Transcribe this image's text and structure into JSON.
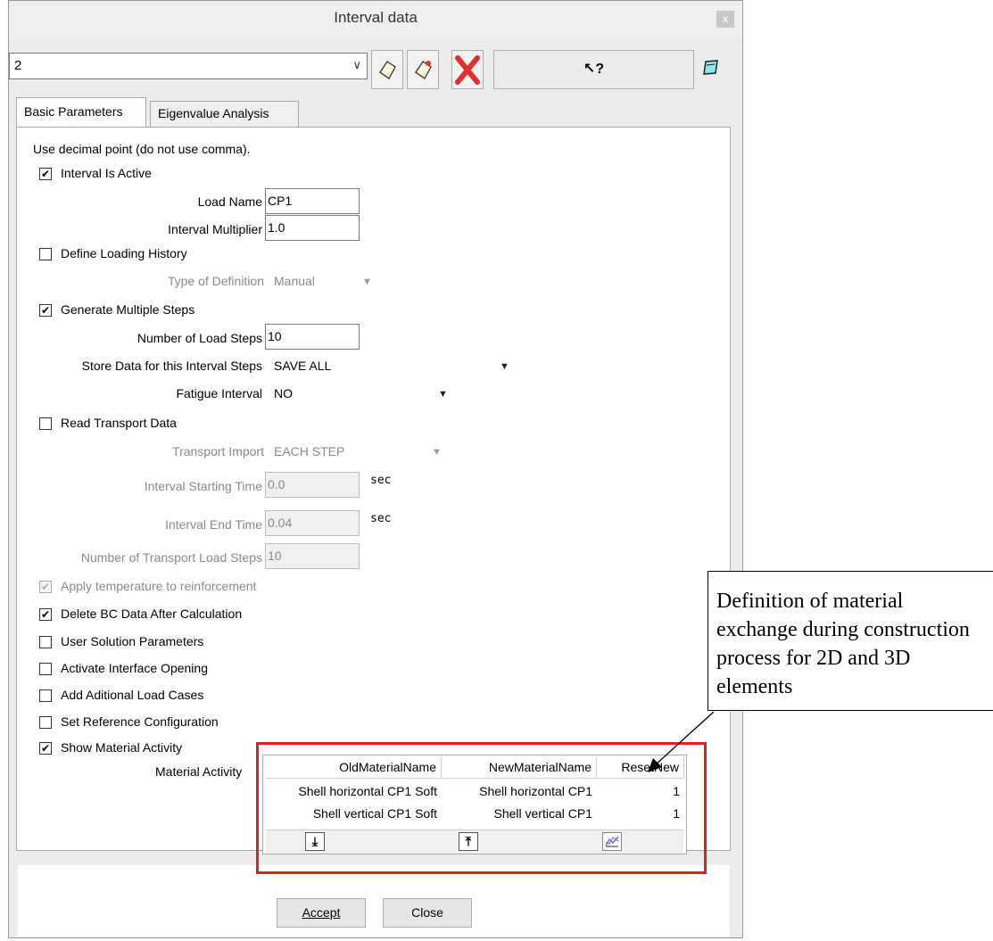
{
  "window": {
    "title": "Interval data",
    "close_glyph": "x"
  },
  "toolbar": {
    "interval_select_value": "2",
    "icons": [
      "add-interval-icon",
      "copy-interval-icon",
      "delete-interval-icon",
      "context-help-icon",
      "notebook-icon"
    ],
    "help_label": "?"
  },
  "tabs": [
    {
      "label": "Basic Parameters",
      "active": true
    },
    {
      "label": "Eigenvalue Analysis",
      "active": false
    }
  ],
  "form": {
    "note": "Use decimal point (do not use comma).",
    "interval_active": {
      "label": "Interval Is Active",
      "checked": true
    },
    "load_name": {
      "label": "Load Name",
      "value": "CP1"
    },
    "interval_multiplier": {
      "label": "Interval Multiplier",
      "value": "1.0"
    },
    "define_loading_history": {
      "label": "Define Loading History",
      "checked": false
    },
    "type_of_definition": {
      "label": "Type of Definition",
      "value": "Manual"
    },
    "generate_multiple_steps": {
      "label": "Generate Multiple Steps",
      "checked": true
    },
    "number_of_load_steps": {
      "label": "Number of Load Steps",
      "value": "10"
    },
    "store_data": {
      "label": "Store Data for this Interval Steps",
      "value": "SAVE ALL"
    },
    "fatigue_interval": {
      "label": "Fatigue Interval",
      "value": "NO"
    },
    "read_transport_data": {
      "label": "Read Transport Data",
      "checked": false
    },
    "transport_import": {
      "label": "Transport Import",
      "value": "EACH STEP"
    },
    "interval_starting_time": {
      "label": "Interval Starting Time",
      "value": "0.0",
      "unit": "sec"
    },
    "interval_end_time": {
      "label": "Interval End Time",
      "value": "0.04",
      "unit": "sec"
    },
    "transport_load_steps": {
      "label": "Number of Transport Load Steps",
      "value": "10"
    },
    "apply_temperature": {
      "label": "Apply temperature to reinforcement",
      "checked": true
    },
    "delete_bc_data": {
      "label": "Delete BC Data After Calculation",
      "checked": true
    },
    "user_solution_parameters": {
      "label": "User Solution Parameters",
      "checked": false
    },
    "activate_interface_opening": {
      "label": "Activate Interface Opening",
      "checked": false
    },
    "add_additional_load_cases": {
      "label": "Add Aditional Load Cases",
      "checked": false
    },
    "set_reference_configuration": {
      "label": "Set Reference Configuration",
      "checked": false
    },
    "show_material_activity": {
      "label": "Show Material Activity",
      "checked": true
    },
    "material_activity_label": "Material Activity"
  },
  "material_table": {
    "columns": [
      "OldMaterialName",
      "NewMaterialName",
      "ResetNew"
    ],
    "rows": [
      [
        "Shell horizontal CP1 Soft",
        "Shell horizontal CP1",
        "1"
      ],
      [
        "Shell vertical CP1 Soft",
        "Shell vertical CP1",
        "1"
      ]
    ],
    "buttons": [
      "move-down-icon",
      "move-top-icon",
      "chart-icon"
    ]
  },
  "footer": {
    "accept_label": "Accept",
    "close_label": "Close"
  },
  "annotation": {
    "text": "Definition of material exchange during construction process for 2D and 3D elements",
    "highlight_color": "#e01f1f"
  },
  "check_glyph": "✔"
}
